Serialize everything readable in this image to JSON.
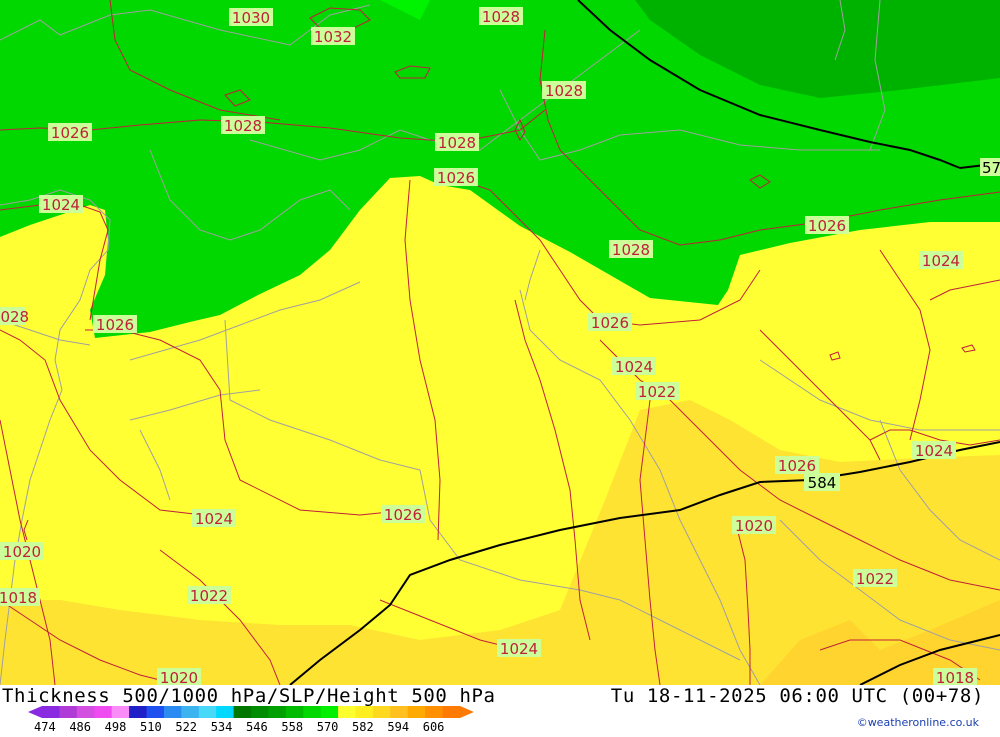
{
  "title": "Thickness 500/1000 hPa/SLP/Height 500 hPa",
  "valid_time": "Tu 18-11-2025 06:00 UTC (00+78)",
  "credit": "©weatheronline.co.uk",
  "legend": {
    "values": [
      "474",
      "486",
      "498",
      "510",
      "522",
      "534",
      "546",
      "558",
      "570",
      "582",
      "594",
      "606"
    ],
    "colors": [
      "#8a2be2",
      "#b03cd8",
      "#d24fe0",
      "#f04bf0",
      "#fa8cf8",
      "#2020c8",
      "#1e50f0",
      "#2a8cf0",
      "#3cb4f0",
      "#48d8f8",
      "#00d8ff",
      "#007800",
      "#008c00",
      "#00a000",
      "#00bb00",
      "#00d800",
      "#00f000",
      "#ffff30",
      "#ffee20",
      "#ffd820",
      "#ffc020",
      "#ffaa00",
      "#ff9000",
      "#ff7a00"
    ]
  },
  "map": {
    "fill_colors": {
      "green_dark": "#00b200",
      "green": "#00d800",
      "green_light": "#00f400",
      "yellow": "#ffff33",
      "yellow_dark": "#ffe333",
      "orange_light": "#ffd42e"
    },
    "isobar_color": "#c0203a",
    "height_line_color": "#000000",
    "border_color": "#a0a0a0",
    "pressure_labels": [
      "1030",
      "1032",
      "1028",
      "1028",
      "1026",
      "1028",
      "1028",
      "1028",
      "1026",
      "1024",
      "1026",
      "1028",
      "1026",
      "1024",
      "1022",
      "1026",
      "1024",
      "1022",
      "1024",
      "1026",
      "1024",
      "1026",
      "1020",
      "1020",
      "1018",
      "1022",
      "1022",
      "1024",
      "1020",
      "1018"
    ],
    "height_labels": [
      "57",
      "584"
    ]
  }
}
